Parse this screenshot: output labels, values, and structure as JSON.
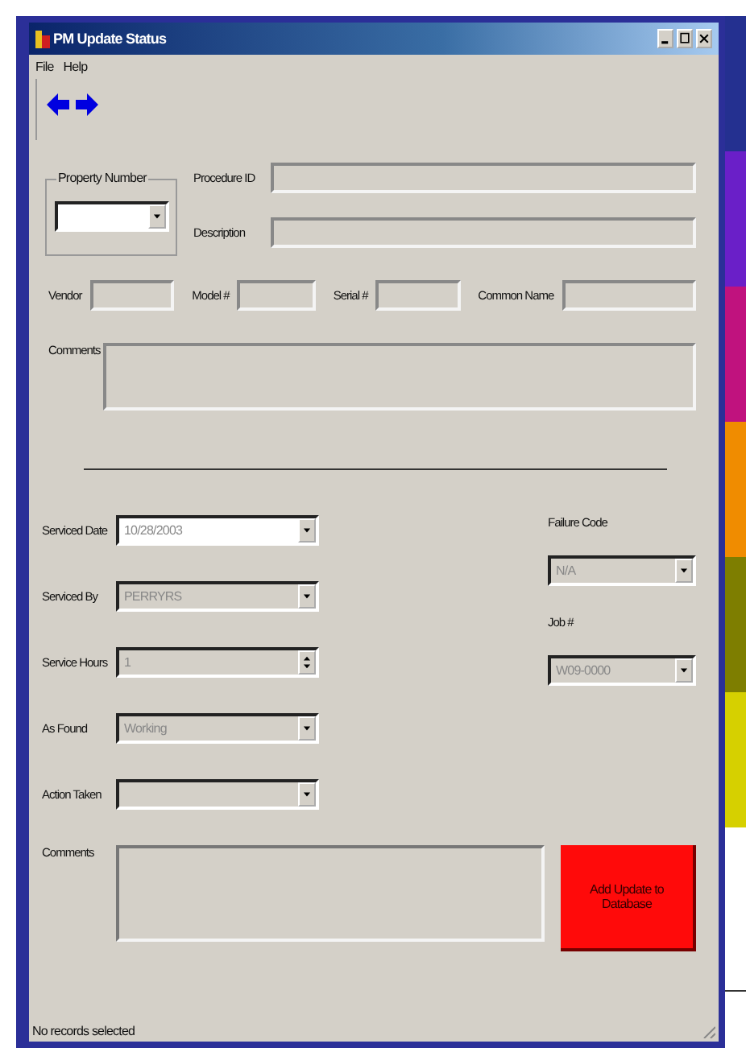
{
  "window": {
    "title": "PM Update Status"
  },
  "menu": [
    "File",
    "Help"
  ],
  "property_number": {
    "label": "Property Number"
  },
  "procedure_id": {
    "label": "Procedure ID"
  },
  "description": {
    "label": "Description"
  },
  "details": [
    {
      "label": "Vendor"
    },
    {
      "label": "Model #"
    },
    {
      "label": "Serial #"
    },
    {
      "label": "Common Name"
    }
  ],
  "comments": {
    "label": "Comments"
  },
  "service": [
    {
      "label": "Serviced Date",
      "value": "10/28/2003",
      "kind": "dropdown",
      "disabled": false
    },
    {
      "label": "Serviced By",
      "value": "PERRYRS",
      "kind": "dropdown",
      "disabled": true
    },
    {
      "label": "Service Hours",
      "value": "1",
      "kind": "spinner",
      "disabled": true
    },
    {
      "label": "As Found",
      "value": "Working",
      "kind": "dropdown",
      "disabled": true
    },
    {
      "label": "Action Taken",
      "kind": "dropdown",
      "disabled": true
    }
  ],
  "failure": [
    {
      "label": "Failure Code",
      "value": "N/A",
      "disabled": true
    },
    {
      "label": "Job #",
      "value": "W09-0000",
      "disabled": true
    }
  ],
  "service_comments": {
    "label": "Comments"
  },
  "submit_button": "Add Update to Database",
  "status_bar": "No records selected"
}
